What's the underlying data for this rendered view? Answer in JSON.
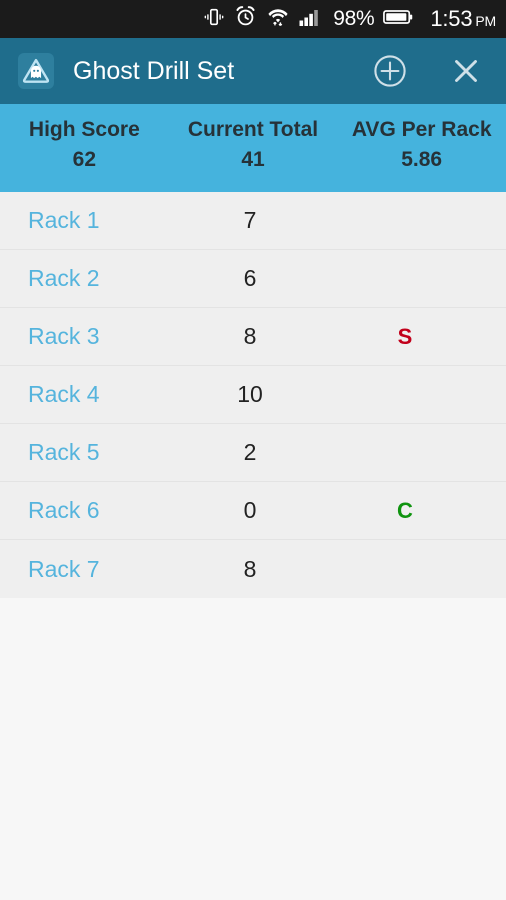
{
  "statusbar": {
    "icons": [
      "vibrate-icon",
      "alarm-clock-icon",
      "wifi-icon",
      "signal-bars-icon",
      "battery-icon"
    ],
    "battery_percent": "98%",
    "time": "1:53",
    "ampm": "PM",
    "background": "#1b1b1b"
  },
  "appbar": {
    "app_icon": "ghost-triangle-logo",
    "title": "Ghost Drill Set",
    "add_icon": "plus-circle-icon",
    "close_icon": "close-icon",
    "background": "#1f6d8c"
  },
  "stats": {
    "background": "#45b3dd",
    "items": [
      {
        "label": "High Score",
        "value": "62"
      },
      {
        "label": "Current Total",
        "value": "41"
      },
      {
        "label": "AVG Per Rack",
        "value": "5.86"
      }
    ]
  },
  "rack_list": {
    "row_background": "#efefef",
    "name_color": "#55b4dd",
    "flag_colors": {
      "S": "#c2001b",
      "C": "#109410"
    },
    "rows": [
      {
        "name": "Rack 1",
        "score": "7",
        "flag": ""
      },
      {
        "name": "Rack 2",
        "score": "6",
        "flag": ""
      },
      {
        "name": "Rack 3",
        "score": "8",
        "flag": "S"
      },
      {
        "name": "Rack 4",
        "score": "10",
        "flag": ""
      },
      {
        "name": "Rack 5",
        "score": "2",
        "flag": ""
      },
      {
        "name": "Rack 6",
        "score": "0",
        "flag": "C"
      },
      {
        "name": "Rack 7",
        "score": "8",
        "flag": ""
      }
    ]
  }
}
